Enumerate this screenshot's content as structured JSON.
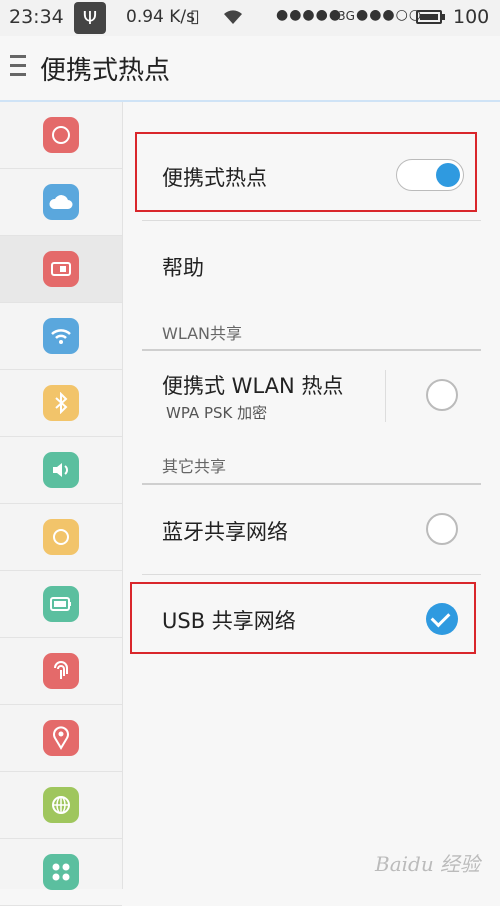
{
  "status_bar": {
    "time": "23:34",
    "speed": "0.94 K/s",
    "signal_1": "●●●●●",
    "network": "3G",
    "signal_2": "●●●○○",
    "battery": "100"
  },
  "header": {
    "title": "便携式热点"
  },
  "sidebar": {
    "items": [
      {
        "icon": "circle-icon",
        "color": "#e46a6a"
      },
      {
        "icon": "cloud-icon",
        "color": "#5aa7dd"
      },
      {
        "icon": "sim-card-icon",
        "color": "#e46a6a",
        "active": true
      },
      {
        "icon": "wifi-icon",
        "color": "#5aa7dd"
      },
      {
        "icon": "bluetooth-icon",
        "color": "#f2c46a"
      },
      {
        "icon": "speaker-icon",
        "color": "#5bbf9f"
      },
      {
        "icon": "brightness-icon",
        "color": "#f2c46a"
      },
      {
        "icon": "battery-icon",
        "color": "#5bbf9f"
      },
      {
        "icon": "fingerprint-icon",
        "color": "#e46a6a"
      },
      {
        "icon": "location-pin-icon",
        "color": "#e46a6a"
      },
      {
        "icon": "globe-icon",
        "color": "#9fc65d"
      },
      {
        "icon": "apps-grid-icon",
        "color": "#5bbf9f"
      }
    ]
  },
  "main": {
    "hotspot_label": "便携式热点",
    "hotspot_on": true,
    "help_label": "帮助",
    "wlan_section": "WLAN共享",
    "wlan_hotspot_label": "便携式 WLAN 热点",
    "wlan_hotspot_sub": "WPA PSK 加密",
    "other_section": "其它共享",
    "bt_tether_label": "蓝牙共享网络",
    "usb_tether_label": "USB 共享网络",
    "usb_checked": true
  },
  "colors": {
    "accent": "#2f9ae0",
    "highlight": "#d9262b"
  },
  "watermark": "Baidu 经验"
}
